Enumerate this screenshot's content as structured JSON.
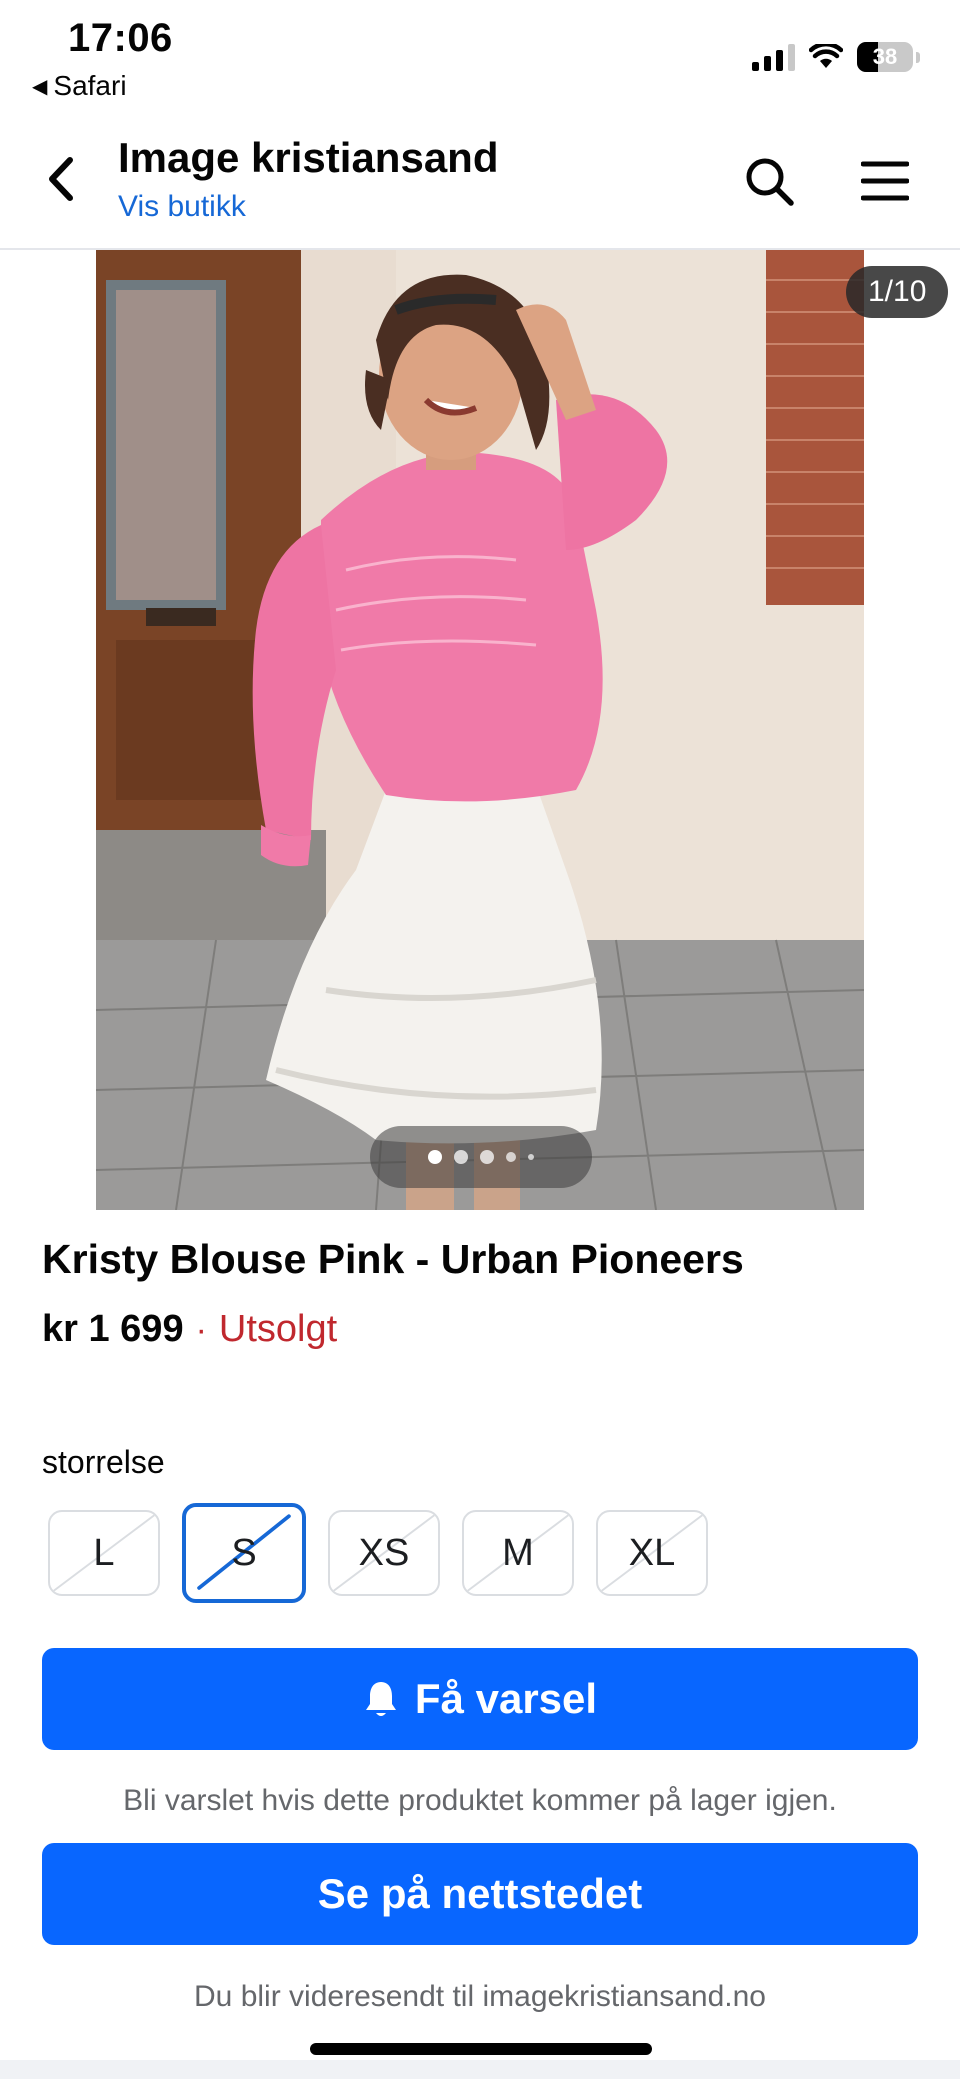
{
  "status_bar": {
    "time": "17:06",
    "back_app": "Safari",
    "battery": "38"
  },
  "header": {
    "title": "Image kristiansand",
    "subtitle": "Vis butikk",
    "icons": {
      "back": "chevron-left-icon",
      "search": "search-icon",
      "menu": "hamburger-menu-icon"
    }
  },
  "gallery": {
    "counter": "1/10",
    "image_description_icon": "product-photo",
    "dots_count": 5,
    "active_dot": 0
  },
  "product": {
    "name": "Kristy Blouse Pink - Urban Pioneers",
    "price": "kr 1 699",
    "separator": "·",
    "availability": "Utsolgt"
  },
  "sizes": {
    "label": "storrelse",
    "options": [
      {
        "label": "L",
        "selected": false,
        "unavailable": true
      },
      {
        "label": "S",
        "selected": true,
        "unavailable": true
      },
      {
        "label": "XS",
        "selected": false,
        "unavailable": true
      },
      {
        "label": "M",
        "selected": false,
        "unavailable": true
      },
      {
        "label": "XL",
        "selected": false,
        "unavailable": true
      }
    ]
  },
  "actions": {
    "notify_label": "Få varsel",
    "notify_icon": "bell-icon",
    "notify_note": "Bli varslet hvis dette produktet kommer på lager igjen.",
    "site_label": "Se på nettstedet",
    "site_note": "Du blir videresendt til imagekristiansand.no"
  },
  "colors": {
    "accent": "#0866ff",
    "link": "#1668d6",
    "soldout": "#c0282e"
  }
}
